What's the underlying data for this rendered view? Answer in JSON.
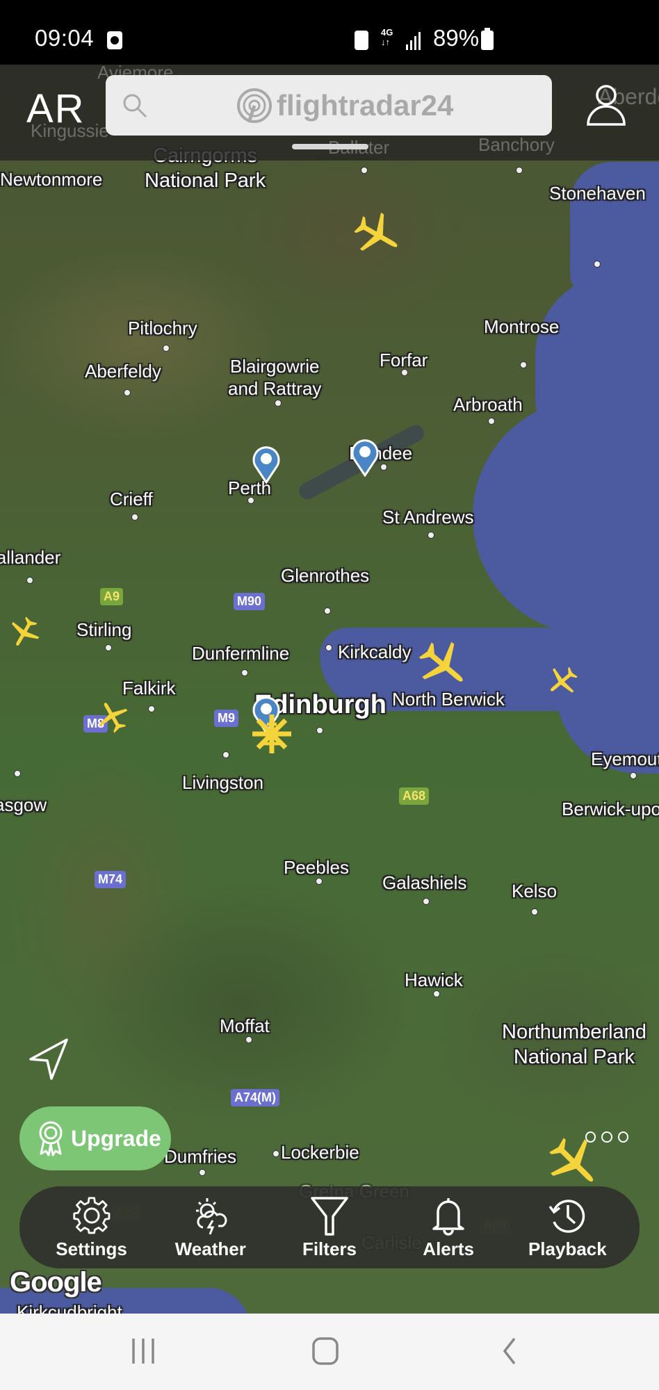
{
  "status_bar": {
    "time": "09:04",
    "network": "4G",
    "battery_percent": "89%"
  },
  "top_bar": {
    "ar_label": "AR",
    "search_placeholder": "flightradar24",
    "faded_labels": [
      "Aviemore",
      "Kingussie",
      "Ballater",
      "Banchory",
      "Aberdeen"
    ]
  },
  "map": {
    "places": [
      {
        "name": "Cairngorms\nNational Park",
        "kind": "park"
      },
      {
        "name": "Newtonmore"
      },
      {
        "name": "Stonehaven"
      },
      {
        "name": "Pitlochry"
      },
      {
        "name": "Montrose"
      },
      {
        "name": "Aberfeldy"
      },
      {
        "name": "Blairgowrie\nand Rattray"
      },
      {
        "name": "Forfar"
      },
      {
        "name": "Arbroath"
      },
      {
        "name": "Dundee"
      },
      {
        "name": "Perth"
      },
      {
        "name": "Crieff"
      },
      {
        "name": "St Andrews"
      },
      {
        "name": "Callander"
      },
      {
        "name": "Glenrothes"
      },
      {
        "name": "Stirling"
      },
      {
        "name": "Dunfermline"
      },
      {
        "name": "Kirkcaldy"
      },
      {
        "name": "Falkirk"
      },
      {
        "name": "Edinburgh",
        "kind": "big"
      },
      {
        "name": "North Berwick"
      },
      {
        "name": "Eyemouth"
      },
      {
        "name": "Livingston"
      },
      {
        "name": "Glasgow"
      },
      {
        "name": "Berwick-upon-Tweed"
      },
      {
        "name": "Peebles"
      },
      {
        "name": "Galashiels"
      },
      {
        "name": "Kelso"
      },
      {
        "name": "Hawick"
      },
      {
        "name": "Moffat"
      },
      {
        "name": "Northumberland\nNational Park",
        "kind": "park"
      },
      {
        "name": "Dumfries"
      },
      {
        "name": "Lockerbie"
      },
      {
        "name": "Gretna Green"
      },
      {
        "name": "Carlisle"
      },
      {
        "name": "Kirkcudbright"
      }
    ],
    "roads": [
      "A9",
      "M90",
      "M9",
      "M8",
      "A68",
      "M74",
      "A74(M)",
      "A75",
      "A69"
    ],
    "attribution": "Google",
    "aircraft_color": "#f5d33a",
    "pin_color": "#4a86c5"
  },
  "actions": {
    "upgrade_label": "Upgrade"
  },
  "toolbar": {
    "items": [
      {
        "label": "Settings",
        "icon": "gear-icon"
      },
      {
        "label": "Weather",
        "icon": "weather-icon"
      },
      {
        "label": "Filters",
        "icon": "filter-icon"
      },
      {
        "label": "Alerts",
        "icon": "bell-icon"
      },
      {
        "label": "Playback",
        "icon": "history-icon"
      }
    ]
  }
}
